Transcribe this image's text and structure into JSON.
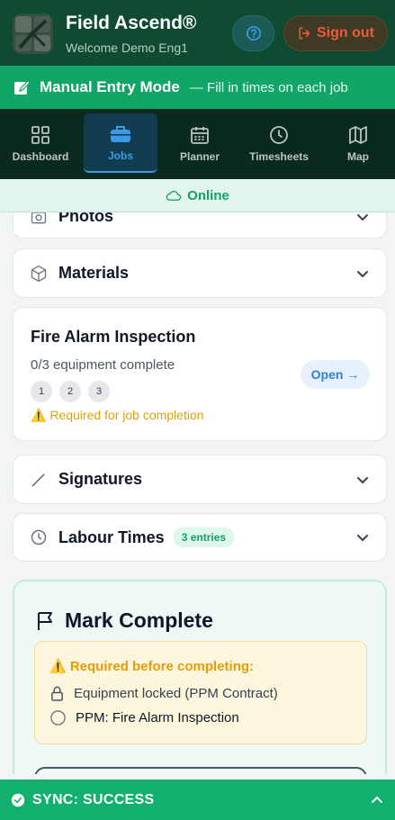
{
  "header": {
    "title": "Field Ascend®",
    "subtitle": "Welcome Demo Eng1",
    "signout_label": "Sign out"
  },
  "manual_mode": {
    "title": "Manual Entry Mode",
    "subtitle": "— Fill in times on each job"
  },
  "nav": {
    "items": [
      {
        "label": "Dashboard",
        "icon": "grid-icon"
      },
      {
        "label": "Jobs",
        "icon": "briefcase-icon",
        "active": true
      },
      {
        "label": "Planner",
        "icon": "calendar-icon"
      },
      {
        "label": "Timesheets",
        "icon": "clock-icon"
      },
      {
        "label": "Map",
        "icon": "map-icon"
      }
    ]
  },
  "status": {
    "online_label": "Online"
  },
  "sections": {
    "photos": "Photos",
    "materials": "Materials",
    "signatures": "Signatures",
    "labour": "Labour Times",
    "labour_badge": "3 entries"
  },
  "job": {
    "title": "Fire Alarm Inspection",
    "progress": "0/3 equipment complete",
    "items": [
      "1",
      "2",
      "3"
    ],
    "warning": "⚠️ Required for job completion",
    "open_label": "Open →"
  },
  "complete": {
    "title": "Mark Complete",
    "required_title": "⚠️ Required before completing:",
    "req_locked": "Equipment locked (PPM Contract)",
    "req_ppm": "PPM: Fire Alarm Inspection"
  },
  "sync": {
    "label": "SYNC: SUCCESS"
  },
  "colors": {
    "header_bg": "#0f4a33",
    "accent_green": "#11a567",
    "nav_bg": "#0a2a1e",
    "active_blue": "#3b9be8",
    "warning": "#e69b09",
    "danger": "#f05a3c"
  }
}
